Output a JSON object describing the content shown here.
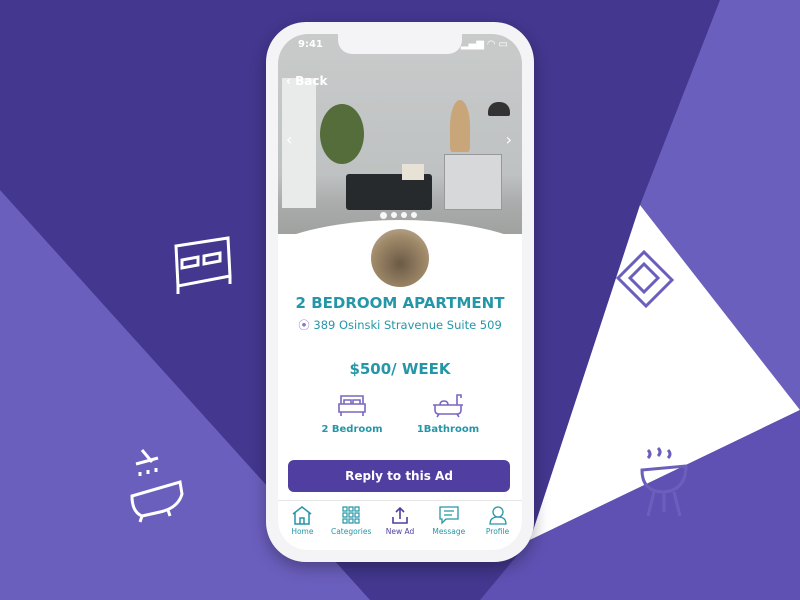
{
  "colors": {
    "bg_dark": "#43378f",
    "bg_light": "#6b5fbe",
    "accent": "#2596a8",
    "button": "#503ea0"
  },
  "status": {
    "time": "9:41"
  },
  "header": {
    "back_label": "Back"
  },
  "carousel": {
    "slides": 4,
    "active": 1
  },
  "listing": {
    "title": "2 BEDROOM APARTMENT",
    "address": "389 Osinski Stravenue Suite 509",
    "price": "$500/ WEEK",
    "features": [
      {
        "icon": "bed-icon",
        "label": "2 Bedroom"
      },
      {
        "icon": "bathtub-icon",
        "label": "1Bathroom"
      }
    ]
  },
  "reply_label": "Reply to this Ad",
  "nav": [
    {
      "icon": "home-icon",
      "label": "Home"
    },
    {
      "icon": "grid-icon",
      "label": "Categories"
    },
    {
      "icon": "upload-icon",
      "label": "New Ad"
    },
    {
      "icon": "message-icon",
      "label": "Message"
    },
    {
      "icon": "profile-icon",
      "label": "Profile"
    }
  ]
}
